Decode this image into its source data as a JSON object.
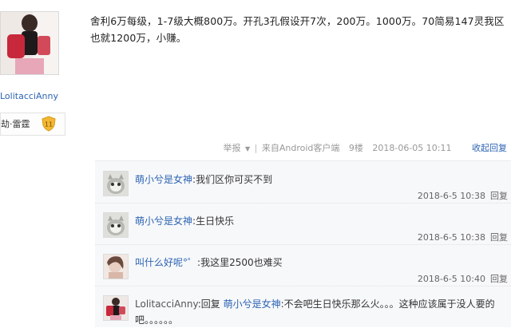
{
  "author": {
    "username": "LolitacciAnny",
    "badge_text": "劫·雷霆",
    "level": "11"
  },
  "post": {
    "content": "舍利6万每级，1-7级大概800万。开孔3孔假设开7次，200万。1000万。70简易147灵我区也就1200万，小赚。",
    "meta": {
      "report": "举报",
      "report_arrow": "▼",
      "sep": "|",
      "source": "来自Android客户端",
      "floor": "9楼",
      "time": "2018-06-05 10:11",
      "collapse": "收起回复"
    }
  },
  "replies": [
    {
      "name": "萌小兮是女神",
      "colon": ":",
      "text": "我们区你可买不到",
      "time": "2018-6-5 10:38",
      "reply_label": "回复"
    },
    {
      "name": "萌小兮是女神",
      "colon": ":",
      "text": "生日快乐",
      "time": "2018-6-5 10:38",
      "reply_label": "回复"
    },
    {
      "name": "叫什么好呢°゜",
      "colon": ":",
      "text": "我这里2500也难买",
      "time": "2018-6-5 10:40",
      "reply_label": "回复"
    },
    {
      "name": "LolitacciAnny",
      "colon": ":",
      "reply_word": "回复",
      "reply_to": "萌小兮是女神",
      "text": ":不会吧生日快乐那么火。。。这种应该属于没人要的吧。。。。。。"
    }
  ]
}
